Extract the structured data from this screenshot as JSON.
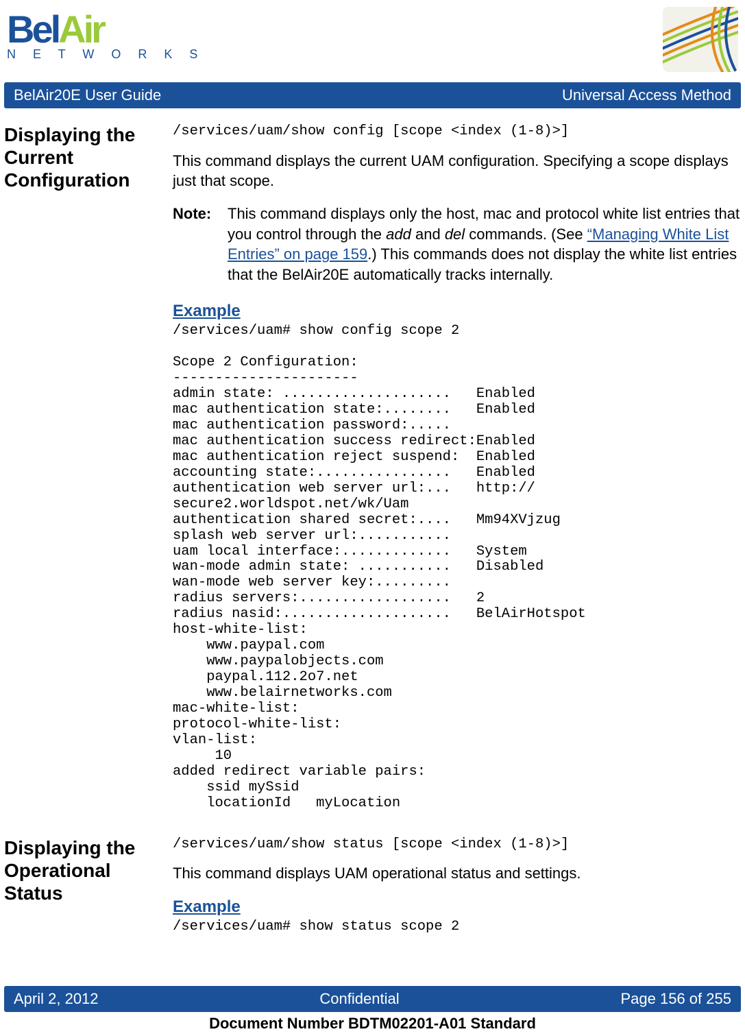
{
  "header": {
    "logo_brand_first": "Bel",
    "logo_brand_second": "Air",
    "logo_subtitle": "N E T W O R K S",
    "barLeft": "BelAir20E User Guide",
    "barRight": "Universal Access Method"
  },
  "section1": {
    "sideHeading": "Displaying the Current Configuration",
    "command": "/services/uam/show config [scope <index (1-8)>]",
    "paragraph": "This command displays the current UAM configuration. Specifying a scope displays just that scope.",
    "noteLabel": "Note:",
    "noteText1": "This command displays only the host, mac and protocol white list entries that you control through the ",
    "noteItalic1": "add",
    "noteText2": " and ",
    "noteItalic2": "del",
    "noteText3": " commands. (See ",
    "noteLink": "“Managing White List Entries” on page 159",
    "noteText4": ".) This commands does not display the white list entries that the BelAir20E automatically tracks internally.",
    "exampleHeading": "Example",
    "exampleOutput": "/services/uam# show config scope 2\n\nScope 2 Configuration:\n----------------------\nadmin state: ....................   Enabled\nmac authentication state:........   Enabled\nmac authentication password:.....\nmac authentication success redirect:Enabled\nmac authentication reject suspend:  Enabled\naccounting state:................   Enabled\nauthentication web server url:...   http://\nsecure2.worldspot.net/wk/Uam\nauthentication shared secret:....   Mm94XVjzug\nsplash web server url:...........\nuam local interface:.............   System\nwan-mode admin state: ...........   Disabled\nwan-mode web server key:.........\nradius servers:..................   2\nradius nasid:....................   BelAirHotspot\nhost-white-list:\n    www.paypal.com\n    www.paypalobjects.com\n    paypal.112.2o7.net\n    www.belairnetworks.com\nmac-white-list:\nprotocol-white-list:\nvlan-list:\n     10\nadded redirect variable pairs:\n    ssid mySsid\n    locationId   myLocation"
  },
  "section2": {
    "sideHeading": "Displaying the Operational Status",
    "command": "/services/uam/show status [scope <index (1-8)>]",
    "paragraph": "This command displays UAM operational status and settings.",
    "exampleHeading": "Example",
    "exampleOutput": "/services/uam# show status scope 2"
  },
  "footer": {
    "left": "April 2, 2012",
    "center": "Confidential",
    "right": "Page 156 of 255",
    "docnum": "Document Number BDTM02201-A01 Standard"
  }
}
